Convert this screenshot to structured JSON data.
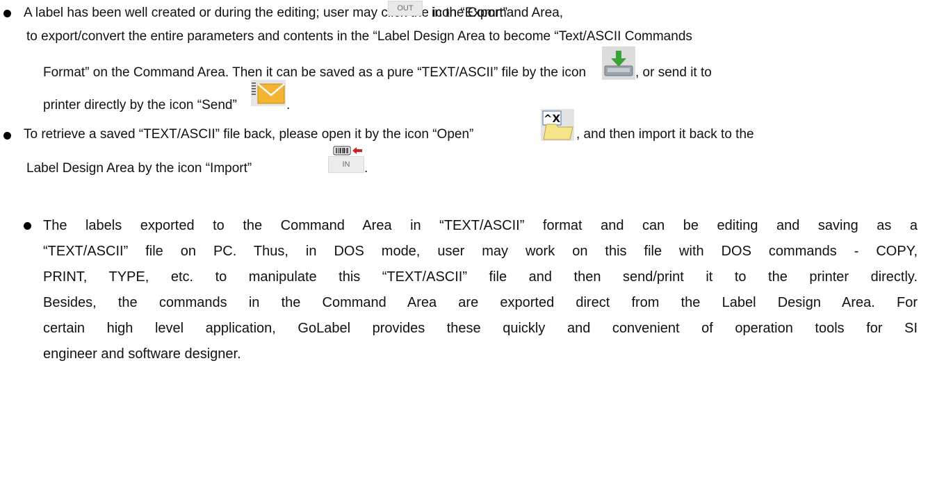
{
  "bullet1": {
    "line1_a": "A label has been well created or during the editing; user may click the icon “Export”",
    "export_icon_text": "OUT",
    "line1_b": "in the Command Area,",
    "line2": "to export/convert the entire parameters and contents in the “Label Design Area to become “Text/ASCII Commands",
    "line3_a": "Format” on the Command Area. Then it can be saved as a pure “TEXT/ASCII” file by the icon",
    "line3_b": ", or send it to",
    "line4_a": "printer directly by the icon “Send”",
    "line4_b": "."
  },
  "bullet2": {
    "line1_a": "To retrieve a saved “TEXT/ASCII” file back, please open it by the icon “Open”",
    "line1_b": ", and then import it back to the",
    "line2_a": "Label Design Area by the icon “Import”",
    "import_icon_text": "IN",
    "line2_b": "."
  },
  "bullet3": {
    "lines": [
      "The labels exported to the Command Area in “TEXT/ASCII” format and can be editing and saving as a",
      "“TEXT/ASCII” file on PC. Thus, in DOS mode, user may work on this file with DOS commands - COPY,",
      "PRINT, TYPE, etc. to manipulate this “TEXT/ASCII” file and then send/print it to the printer directly.",
      "Besides, the commands in the Command Area are exported direct from the Label Design Area. For",
      "certain high level application, GoLabel provides these quickly and convenient of operation tools for SI",
      "engineer and software designer."
    ]
  },
  "icons": {
    "export": "export-out-icon",
    "save": "save-disk-icon",
    "send": "send-envelope-icon",
    "open": "open-folder-icon",
    "import": "import-in-icon"
  },
  "colors": {
    "save_arrow": "#3aa23a",
    "envelope": "#f2b431",
    "folder": "#f5e48a",
    "import_arrow": "#d21f1f"
  }
}
